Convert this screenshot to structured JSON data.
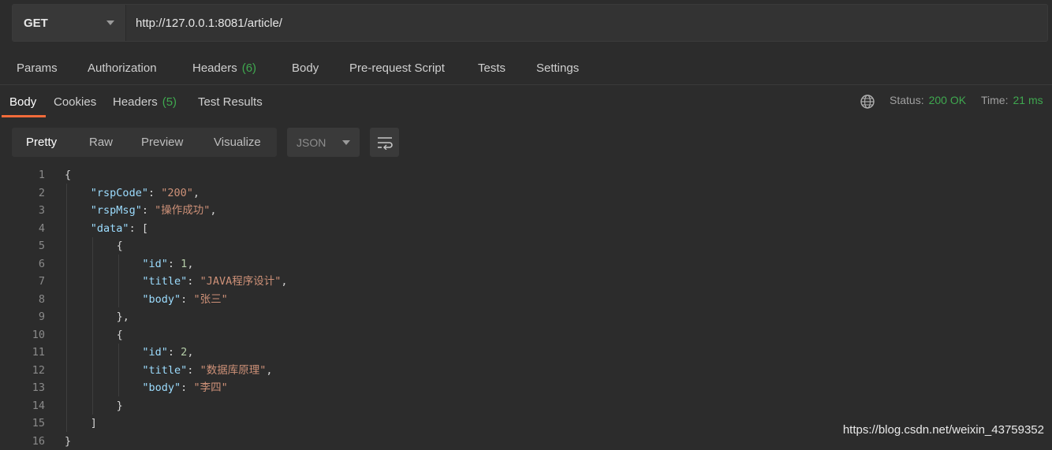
{
  "request": {
    "method": "GET",
    "url": "http://127.0.0.1:8081/article/"
  },
  "request_tabs": {
    "params": "Params",
    "authorization": "Authorization",
    "headers": "Headers",
    "headers_count": "(6)",
    "body": "Body",
    "pre_request": "Pre-request Script",
    "tests": "Tests",
    "settings": "Settings"
  },
  "response_tabs": {
    "body": "Body",
    "cookies": "Cookies",
    "headers": "Headers",
    "headers_count": "(5)",
    "test_results": "Test Results"
  },
  "status": {
    "status_label": "Status:",
    "status_value": "200 OK",
    "time_label": "Time:",
    "time_value": "21 ms"
  },
  "view_modes": {
    "pretty": "Pretty",
    "raw": "Raw",
    "preview": "Preview",
    "visualize": "Visualize"
  },
  "format": "JSON",
  "code_lines": [
    {
      "n": "1",
      "text": "{"
    },
    {
      "n": "2",
      "key": "\"rspCode\"",
      "sep": ": ",
      "val": "\"200\"",
      "vt": "str",
      "end": ","
    },
    {
      "n": "3",
      "key": "\"rspMsg\"",
      "sep": ": ",
      "val": "\"操作成功\"",
      "vt": "str",
      "end": ","
    },
    {
      "n": "4",
      "key": "\"data\"",
      "sep": ": ",
      "val": "",
      "vt": "str",
      "end": "["
    },
    {
      "n": "5",
      "text": "{"
    },
    {
      "n": "6",
      "key": "\"id\"",
      "sep": ": ",
      "val": "1",
      "vt": "num",
      "end": ","
    },
    {
      "n": "7",
      "key": "\"title\"",
      "sep": ": ",
      "val": "\"JAVA程序设计\"",
      "vt": "str",
      "end": ","
    },
    {
      "n": "8",
      "key": "\"body\"",
      "sep": ": ",
      "val": "\"张三\"",
      "vt": "str",
      "end": ""
    },
    {
      "n": "9",
      "text": "},"
    },
    {
      "n": "10",
      "text": "{"
    },
    {
      "n": "11",
      "key": "\"id\"",
      "sep": ": ",
      "val": "2",
      "vt": "num",
      "end": ","
    },
    {
      "n": "12",
      "key": "\"title\"",
      "sep": ": ",
      "val": "\"数据库原理\"",
      "vt": "str",
      "end": ","
    },
    {
      "n": "13",
      "key": "\"body\"",
      "sep": ": ",
      "val": "\"李四\"",
      "vt": "str",
      "end": ""
    },
    {
      "n": "14",
      "text": "}"
    },
    {
      "n": "15",
      "text": "]"
    },
    {
      "n": "16",
      "text": "}"
    }
  ],
  "watermark": "https://blog.csdn.net/weixin_43759352",
  "colors": {
    "accent": "#f26b3a",
    "success": "#3fa84f",
    "background": "#2c2c2c"
  }
}
